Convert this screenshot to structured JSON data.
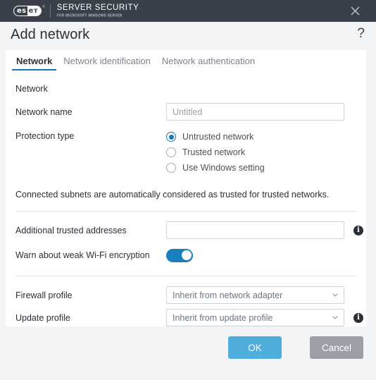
{
  "titlebar": {
    "brand_mark_left": "es",
    "brand_mark_right": "eт",
    "trademark": "®",
    "product_line1": "SERVER SECURITY",
    "product_line2": "FOR MICROSOFT WINDOWS SERVER",
    "close_icon": "close-icon"
  },
  "dialog": {
    "title": "Add network",
    "help_icon": "?"
  },
  "tabs": [
    {
      "label": "Network",
      "active": true
    },
    {
      "label": "Network identification",
      "active": false
    },
    {
      "label": "Network authentication",
      "active": false
    }
  ],
  "form": {
    "section_label": "Network",
    "network_name": {
      "label": "Network name",
      "value": "",
      "placeholder": "Untitled"
    },
    "protection_type": {
      "label": "Protection type",
      "options": [
        {
          "label": "Untrusted network",
          "selected": true
        },
        {
          "label": "Trusted network",
          "selected": false
        },
        {
          "label": "Use Windows setting",
          "selected": false
        }
      ]
    },
    "note": "Connected subnets are automatically considered as trusted for trusted networks.",
    "additional_trusted_addresses": {
      "label": "Additional trusted addresses",
      "value": "",
      "placeholder": "",
      "info_icon": "info-icon"
    },
    "warn_weak_wifi": {
      "label": "Warn about weak Wi-Fi encryption",
      "enabled": true
    },
    "firewall_profile": {
      "label": "Firewall profile",
      "value": "Inherit from network adapter"
    },
    "update_profile": {
      "label": "Update profile",
      "value": "Inherit from update profile",
      "info_icon": "info-icon"
    }
  },
  "footer": {
    "ok_label": "OK",
    "cancel_label": "Cancel"
  },
  "colors": {
    "titlebar_bg": "#3a4049",
    "accent_blue": "#1478b4",
    "ok_button": "#4fadda",
    "cancel_button": "#9aa0a6",
    "toggle_on": "#1a80bd",
    "panel_bg": "#ffffff",
    "window_bg": "#f2f4f6"
  }
}
